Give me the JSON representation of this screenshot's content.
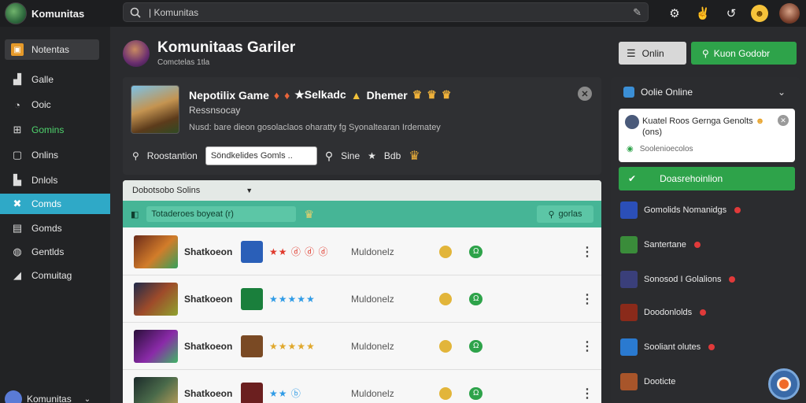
{
  "app": {
    "title": "Komunitas"
  },
  "search": {
    "placeholder": "Komunitas",
    "value": "| Komunitas"
  },
  "sidebar": {
    "items": [
      {
        "label": "Notentas",
        "icon": "home-icon"
      },
      {
        "label": "Galle",
        "icon": "chart-icon"
      },
      {
        "label": "Ooic",
        "icon": "clock-icon"
      },
      {
        "label": "Gomins",
        "icon": "grid-icon"
      },
      {
        "label": "Onlins",
        "icon": "square-icon"
      },
      {
        "label": "Dnlols",
        "icon": "bookmark-icon"
      },
      {
        "label": "Comds",
        "icon": "wrench-icon"
      },
      {
        "label": "Gomds",
        "icon": "file-icon"
      },
      {
        "label": "Gentlds",
        "icon": "chat-icon"
      },
      {
        "label": "Comuitag",
        "icon": "tag-icon"
      }
    ],
    "footer_label": "Komunitas"
  },
  "header": {
    "title": "Komunitaas Gariler",
    "subtitle": "Comctelas 1tla",
    "btn_online": "Onlin",
    "btn_green": "Kuon Godobr"
  },
  "feature": {
    "title": "Nepotilix Game",
    "title_extra": "★Selkadc",
    "title_extra2": "Dhemer",
    "subtitle": "Ressnsocay",
    "desc": "Nusd: bare dieon gosolaclaos oharatty fg Syonaltearan Irdematey",
    "label_action": "Roostantion",
    "input_value": "Söndkelides Gomls ..",
    "label_search": "Sine",
    "label_bdb": "Bdb"
  },
  "list": {
    "header": "Dobotsobo Solins",
    "filter_value": "Totaderoes boyeat (r)",
    "search_label": "gorlas",
    "rows": [
      {
        "name": "Shatkoeon",
        "stars": "★★ ⓓ ⓓ ⓓ",
        "status": "Muldonelz",
        "pill": "Ω",
        "thumb": "linear-gradient(135deg,#6b2b1a,#d27c2a 55%,#35a05a)",
        "icon": "#2a5fb8"
      },
      {
        "name": "Shatkoeon",
        "stars": "★★★★★",
        "status": "Muldonelz",
        "pill": "Ω",
        "thumb": "linear-gradient(135deg,#1f2a4a,#9e4b2a 50%,#8fa32f)",
        "icon": "#1a7f3c"
      },
      {
        "name": "Shatkoeon",
        "stars": "★★★★★",
        "status": "Muldonelz",
        "pill": "Ω",
        "thumb": "linear-gradient(135deg,#2a0f3a,#8a2aa8 55%,#3fb565)",
        "icon": "#7a4a24"
      },
      {
        "name": "Shatkoeon",
        "stars": "★★ ⓑ",
        "status": "Muldonelz",
        "pill": "Ω",
        "thumb": "linear-gradient(135deg,#1b2a2a,#4a6a4a 50%,#c2a25a)",
        "icon": "#6b1f1f"
      }
    ],
    "star_colors": [
      "#e0392c",
      "#2f9be6",
      "#e0a82c",
      "#2f9be6"
    ]
  },
  "right_panel": {
    "title": "Oolie Online",
    "card_title": "Kuatel Roos Gernga Genolts",
    "card_sub": "(ons)",
    "card_footer": "Soolenioecolos",
    "btn": "Doasrehoinlion",
    "items": [
      {
        "label": "Gomolids Nomanidgs",
        "color": "#2b4fb8"
      },
      {
        "label": "Santertane",
        "color": "#3a8c3a"
      },
      {
        "label": "Sonosod I Golalions",
        "color": "#3a3f7a"
      },
      {
        "label": "Doodonlolds",
        "color": "#8a2a1a"
      },
      {
        "label": "Sooliant olutes",
        "color": "#2a7ad0"
      },
      {
        "label": "Dooticte",
        "color": "#a8552a"
      }
    ]
  },
  "colors": {
    "accent": "#2fa9c7",
    "green": "#2ea34a",
    "teal": "#46b596"
  }
}
